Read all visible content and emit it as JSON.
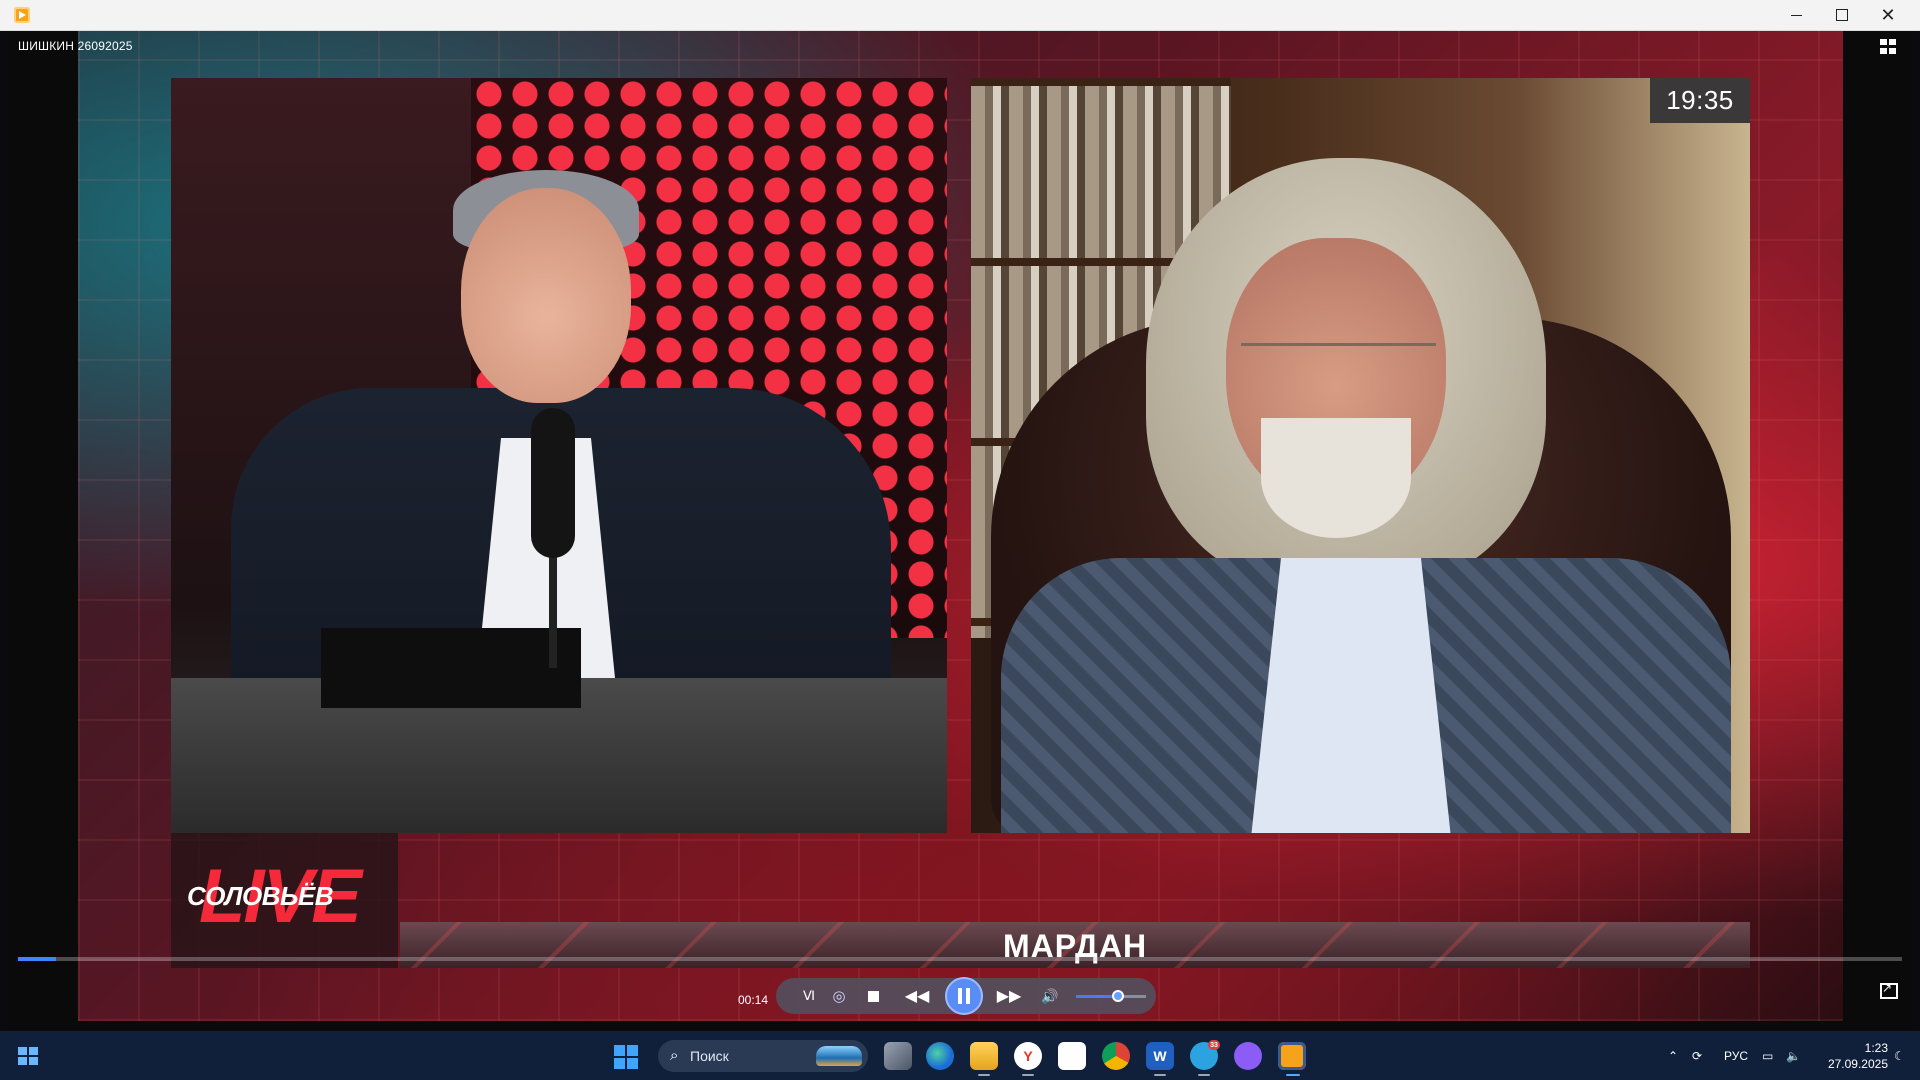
{
  "window": {
    "controls": {
      "minimize": "—",
      "maximize": "□",
      "close": "✕"
    }
  },
  "video": {
    "file_title": "ШИШКИН 26092025",
    "overlay_clock": "19:35",
    "logo_small": "СОЛОВЬЁВ",
    "logo_large": "LIVE",
    "speaker_name": "МАРДАН"
  },
  "player": {
    "elapsed": "00:14",
    "progress_fraction": 0.02,
    "volume_fraction": 0.6,
    "buttons": {
      "ab": "Ⅵ",
      "loop": "◎",
      "rewind": "◀◀",
      "fast_forward": "▶▶",
      "volume": "🔊"
    }
  },
  "taskbar": {
    "search_placeholder": "Поиск",
    "language": "РУС",
    "time": "1:23",
    "date": "27.09.2025",
    "telegram_badge": "33",
    "apps": [
      "task-view",
      "edge",
      "file-explorer",
      "yandex-browser",
      "microsoft-store",
      "chrome",
      "word",
      "telegram",
      "app-purple",
      "media-player"
    ]
  },
  "colors": {
    "accent": "#5a8cf5",
    "taskbar": "#101f3a",
    "logo_red": "#ff2b3c"
  }
}
